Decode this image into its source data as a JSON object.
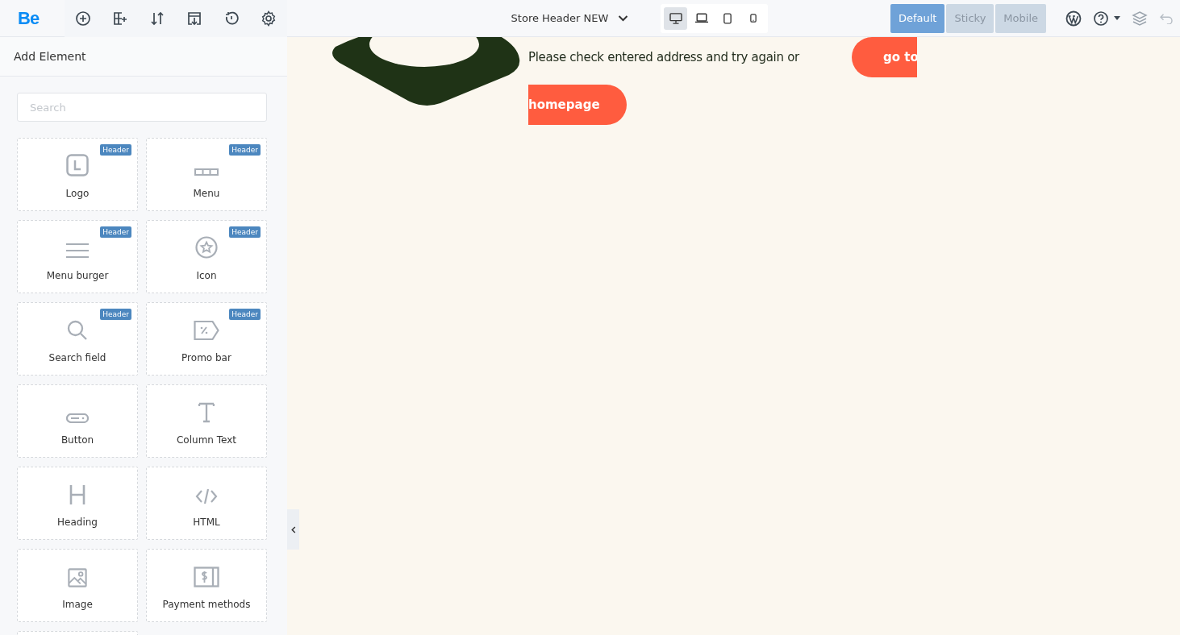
{
  "toolbar": {
    "logo": "Be",
    "tools": [
      {
        "kind": "add"
      },
      {
        "kind": "layout"
      },
      {
        "kind": "sort"
      },
      {
        "kind": "export"
      },
      {
        "kind": "history"
      },
      {
        "kind": "settings"
      }
    ]
  },
  "header_selector": {
    "label": "Store Header NEW"
  },
  "devices": [
    {
      "kind": "desktop",
      "selected": true
    },
    {
      "kind": "laptop",
      "selected": false
    },
    {
      "kind": "tablet",
      "selected": false
    },
    {
      "kind": "phone",
      "selected": false
    }
  ],
  "modes": [
    {
      "label": "Default",
      "selected": true
    },
    {
      "label": "Sticky",
      "selected": false
    },
    {
      "label": "Mobile",
      "selected": false
    }
  ],
  "sidebar": {
    "title": "Add Element",
    "search": {
      "placeholder": "Search"
    },
    "elements": [
      {
        "label": "Logo",
        "kind": "logo",
        "badge": "Header"
      },
      {
        "label": "Menu",
        "kind": "menu",
        "badge": "Header"
      },
      {
        "label": "Menu burger",
        "kind": "burger",
        "badge": "Header"
      },
      {
        "label": "Icon",
        "kind": "star",
        "badge": "Header"
      },
      {
        "label": "Search field",
        "kind": "search",
        "badge": "Header"
      },
      {
        "label": "Promo bar",
        "kind": "promo",
        "badge": "Header"
      },
      {
        "label": "Button",
        "kind": "button"
      },
      {
        "label": "Column Text",
        "kind": "text"
      },
      {
        "label": "Heading",
        "kind": "heading"
      },
      {
        "label": "HTML",
        "kind": "code"
      },
      {
        "label": "Image",
        "kind": "image"
      },
      {
        "label": "Payment methods",
        "kind": "payment"
      }
    ]
  },
  "canvas": {
    "message": "Please check entered address and try again or",
    "button_part_1": "go to",
    "button_part_2": "homepage"
  }
}
